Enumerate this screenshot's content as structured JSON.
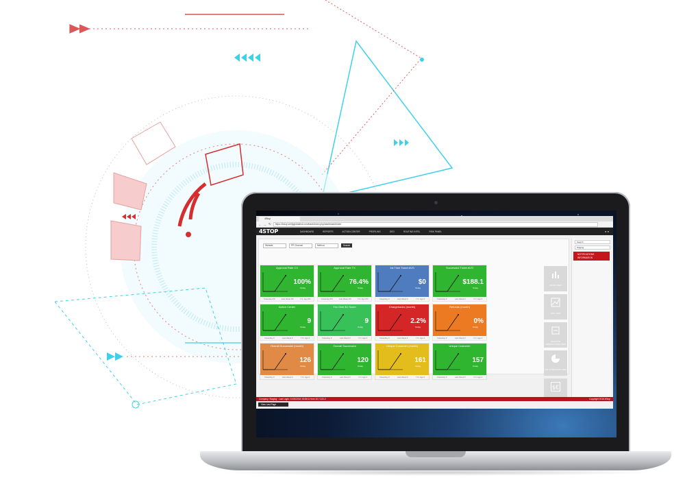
{
  "colors": {
    "accent_red": "#d42e2e",
    "accent_cyan": "#3fd0ea",
    "nav_dark": "#222222"
  },
  "browser": {
    "tab_title": "4Stop",
    "url": "https://4stop.verifyglobalrisk.com/bank/index.php/dashboard/index"
  },
  "app": {
    "logo": "4STOP",
    "nav": [
      "DASHBOARD",
      "REPORTS",
      "ACTION CENTER",
      "PROFILING",
      "GEO",
      "ROUTING INTEL",
      "RISK PANEL"
    ]
  },
  "filters": {
    "website": "Website",
    "channel": "PP Channel",
    "method": "Method",
    "search_label": "Search"
  },
  "cards": [
    {
      "title": "Approval Rate CX",
      "value": "100%",
      "sub": "Today",
      "color": "#2fb52f",
      "foot": [
        "Yesterday 0%",
        "Last Week 0%",
        "Y.O. Ago 0%"
      ]
    },
    {
      "title": "Approval Rate TX",
      "value": "76.4%",
      "sub": "Today",
      "color": "#2fb52f",
      "foot": [
        "Yesterday 0%",
        "Last Week 0%",
        "Y.O. Ago 0%"
      ]
    },
    {
      "title": "1st Time Ticket AVG",
      "value": "$0",
      "sub": "Today",
      "color": "#4f7bbf",
      "foot": [
        "Yesterday 0",
        "Last Week 0",
        "Y.O. Ago 0"
      ]
    },
    {
      "title": "Successful Ticket AVG",
      "value": "$188.1",
      "sub": "Today",
      "color": "#2fb52f",
      "foot": [
        "Yesterday 0",
        "Last Week 0",
        "Y.O. Ago 0"
      ]
    },
    {
      "title": "Action Center",
      "value": "9",
      "sub": "Today",
      "color": "#2fb52f",
      "foot": [
        "Yesterday 0",
        "Last Week 0",
        "Y.O. Ago 0"
      ]
    },
    {
      "title": "Txn Over $1 Score",
      "value": "9",
      "sub": "Today",
      "color": "#39c159",
      "foot": [
        "Yesterday 0",
        "Last Week 0",
        "Y.O. Ago 0"
      ]
    },
    {
      "title": "Chargebacks (month)",
      "value": "2.2%",
      "sub": "Today",
      "color": "#d42626",
      "foot": [
        "Yesterday 0",
        "Last Week 0",
        "Y.O. Ago 0"
      ]
    },
    {
      "title": "Refunds (month)",
      "value": "0%",
      "sub": "Today",
      "color": "#ec7a22",
      "foot": [
        "Yesterday 0",
        "Last Week 0",
        "Y.O. Ago 0"
      ]
    },
    {
      "title": "Overall Successful (month)",
      "value": "126",
      "sub": "Today",
      "color": "#e08a46",
      "foot": [
        "Yesterday 0",
        "Last Week 0",
        "Y.O. Ago 0"
      ]
    },
    {
      "title": "Overall Successful",
      "value": "120",
      "sub": "Today",
      "color": "#2fb52f",
      "foot": [
        "Yesterday 0",
        "Last Week 0",
        "Y.O. Ago 0"
      ]
    },
    {
      "title": "Unique Customer (month)",
      "value": "161",
      "sub": "Today",
      "color": "#e2bd1c",
      "foot": [
        "Yesterday 0",
        "Last Week 0",
        "Y.O. Ago 0"
      ]
    },
    {
      "title": "Unique Customer",
      "value": "157",
      "sub": "Today",
      "color": "#2fb52f",
      "foot": [
        "Yesterday 0",
        "Last Week 0",
        "Y.O. Ago 0"
      ]
    }
  ],
  "side_icons": [
    {
      "label": "SALES VIEW",
      "icon": "bar-chart-icon"
    },
    {
      "label": "RISK VIEW",
      "icon": "line-chart-icon"
    },
    {
      "label": "NEGATIVE TRANSACTIONS VIEW",
      "icon": "negative-icon"
    },
    {
      "label": "TOP 10 DEPOSITS VIEW",
      "icon": "pie-chart-icon"
    },
    {
      "label": "",
      "icon": "currency-icon"
    }
  ],
  "right_panel": {
    "search_placeholder": "Search",
    "environment": "Staging",
    "notifications": "NOTIFICATIONS",
    "information": "INFORMATION"
  },
  "footer": {
    "left": "Company: Staging · Last Login: 11/02/2016 15:06:11 from 10.7.222.2",
    "right": "Copyright 2016 4Stop",
    "view_last_page": "View Last Page"
  }
}
